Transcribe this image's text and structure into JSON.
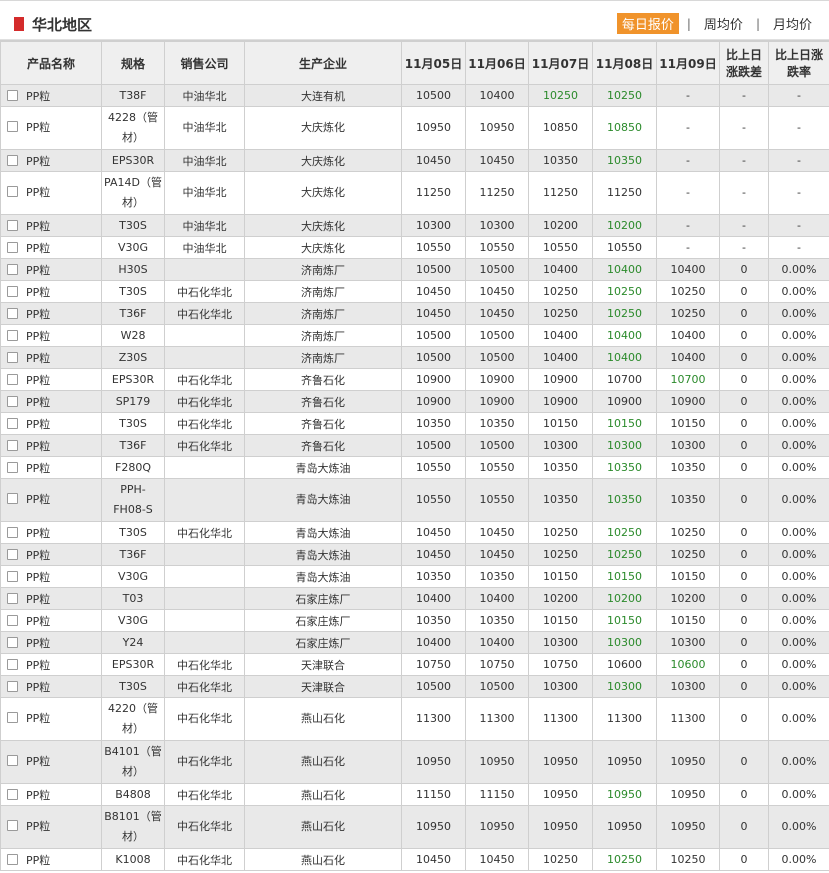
{
  "region": {
    "title": "华北地区"
  },
  "tabs": [
    "每日报价",
    "周均价",
    "月均价"
  ],
  "colors": {
    "accent": "#f0932b",
    "region_mark": "#d42b2b",
    "price_down": "#2b8a2b"
  },
  "columns": [
    "产品名称",
    "规格",
    "销售公司",
    "生产企业",
    "11月05日",
    "11月06日",
    "11月07日",
    "11月08日",
    "11月09日",
    "比上日涨跌差",
    "比上日涨跌率"
  ],
  "rows": [
    {
      "product": "PP粒",
      "spec": "T38F",
      "seller": "中油华北",
      "maker": "大连有机",
      "p1": "10500",
      "p2": "10400",
      "p3": "10250",
      "p4": "10250",
      "p5": "-",
      "diff": "-",
      "rate": "-",
      "down": [
        2,
        3
      ],
      "tall": false
    },
    {
      "product": "PP粒",
      "spec": "4228（管材）",
      "seller": "中油华北",
      "maker": "大庆炼化",
      "p1": "10950",
      "p2": "10950",
      "p3": "10850",
      "p4": "10850",
      "p5": "-",
      "diff": "-",
      "rate": "-",
      "down": [
        3
      ],
      "tall": true
    },
    {
      "product": "PP粒",
      "spec": "EPS30R",
      "seller": "中油华北",
      "maker": "大庆炼化",
      "p1": "10450",
      "p2": "10450",
      "p3": "10350",
      "p4": "10350",
      "p5": "-",
      "diff": "-",
      "rate": "-",
      "down": [
        3
      ],
      "tall": false
    },
    {
      "product": "PP粒",
      "spec": "PA14D（管材）",
      "seller": "中油华北",
      "maker": "大庆炼化",
      "p1": "11250",
      "p2": "11250",
      "p3": "11250",
      "p4": "11250",
      "p5": "-",
      "diff": "-",
      "rate": "-",
      "down": [],
      "tall": true
    },
    {
      "product": "PP粒",
      "spec": "T30S",
      "seller": "中油华北",
      "maker": "大庆炼化",
      "p1": "10300",
      "p2": "10300",
      "p3": "10200",
      "p4": "10200",
      "p5": "-",
      "diff": "-",
      "rate": "-",
      "down": [
        3
      ],
      "tall": false
    },
    {
      "product": "PP粒",
      "spec": "V30G",
      "seller": "中油华北",
      "maker": "大庆炼化",
      "p1": "10550",
      "p2": "10550",
      "p3": "10550",
      "p4": "10550",
      "p5": "-",
      "diff": "-",
      "rate": "-",
      "down": [],
      "tall": false
    },
    {
      "product": "PP粒",
      "spec": "H30S",
      "seller": "",
      "maker": "济南炼厂",
      "p1": "10500",
      "p2": "10500",
      "p3": "10400",
      "p4": "10400",
      "p5": "10400",
      "diff": "0",
      "rate": "0.00%",
      "down": [
        3
      ],
      "tall": false
    },
    {
      "product": "PP粒",
      "spec": "T30S",
      "seller": "中石化华北",
      "maker": "济南炼厂",
      "p1": "10450",
      "p2": "10450",
      "p3": "10250",
      "p4": "10250",
      "p5": "10250",
      "diff": "0",
      "rate": "0.00%",
      "down": [
        3
      ],
      "tall": false
    },
    {
      "product": "PP粒",
      "spec": "T36F",
      "seller": "中石化华北",
      "maker": "济南炼厂",
      "p1": "10450",
      "p2": "10450",
      "p3": "10250",
      "p4": "10250",
      "p5": "10250",
      "diff": "0",
      "rate": "0.00%",
      "down": [
        3
      ],
      "tall": false
    },
    {
      "product": "PP粒",
      "spec": "W28",
      "seller": "",
      "maker": "济南炼厂",
      "p1": "10500",
      "p2": "10500",
      "p3": "10400",
      "p4": "10400",
      "p5": "10400",
      "diff": "0",
      "rate": "0.00%",
      "down": [
        3
      ],
      "tall": false
    },
    {
      "product": "PP粒",
      "spec": "Z30S",
      "seller": "",
      "maker": "济南炼厂",
      "p1": "10500",
      "p2": "10500",
      "p3": "10400",
      "p4": "10400",
      "p5": "10400",
      "diff": "0",
      "rate": "0.00%",
      "down": [
        3
      ],
      "tall": false
    },
    {
      "product": "PP粒",
      "spec": "EPS30R",
      "seller": "中石化华北",
      "maker": "齐鲁石化",
      "p1": "10900",
      "p2": "10900",
      "p3": "10900",
      "p4": "10700",
      "p5": "10700",
      "diff": "0",
      "rate": "0.00%",
      "down": [
        4
      ],
      "tall": false
    },
    {
      "product": "PP粒",
      "spec": "SP179",
      "seller": "中石化华北",
      "maker": "齐鲁石化",
      "p1": "10900",
      "p2": "10900",
      "p3": "10900",
      "p4": "10900",
      "p5": "10900",
      "diff": "0",
      "rate": "0.00%",
      "down": [],
      "tall": false
    },
    {
      "product": "PP粒",
      "spec": "T30S",
      "seller": "中石化华北",
      "maker": "齐鲁石化",
      "p1": "10350",
      "p2": "10350",
      "p3": "10150",
      "p4": "10150",
      "p5": "10150",
      "diff": "0",
      "rate": "0.00%",
      "down": [
        3
      ],
      "tall": false
    },
    {
      "product": "PP粒",
      "spec": "T36F",
      "seller": "中石化华北",
      "maker": "齐鲁石化",
      "p1": "10500",
      "p2": "10500",
      "p3": "10300",
      "p4": "10300",
      "p5": "10300",
      "diff": "0",
      "rate": "0.00%",
      "down": [
        3
      ],
      "tall": false
    },
    {
      "product": "PP粒",
      "spec": "F280Q",
      "seller": "",
      "maker": "青岛大炼油",
      "p1": "10550",
      "p2": "10550",
      "p3": "10350",
      "p4": "10350",
      "p5": "10350",
      "diff": "0",
      "rate": "0.00%",
      "down": [
        3
      ],
      "tall": false
    },
    {
      "product": "PP粒",
      "spec": "PPH-FH08-S",
      "seller": "",
      "maker": "青岛大炼油",
      "p1": "10550",
      "p2": "10550",
      "p3": "10350",
      "p4": "10350",
      "p5": "10350",
      "diff": "0",
      "rate": "0.00%",
      "down": [
        3
      ],
      "tall": true
    },
    {
      "product": "PP粒",
      "spec": "T30S",
      "seller": "中石化华北",
      "maker": "青岛大炼油",
      "p1": "10450",
      "p2": "10450",
      "p3": "10250",
      "p4": "10250",
      "p5": "10250",
      "diff": "0",
      "rate": "0.00%",
      "down": [
        3
      ],
      "tall": false
    },
    {
      "product": "PP粒",
      "spec": "T36F",
      "seller": "",
      "maker": "青岛大炼油",
      "p1": "10450",
      "p2": "10450",
      "p3": "10250",
      "p4": "10250",
      "p5": "10250",
      "diff": "0",
      "rate": "0.00%",
      "down": [
        3
      ],
      "tall": false
    },
    {
      "product": "PP粒",
      "spec": "V30G",
      "seller": "",
      "maker": "青岛大炼油",
      "p1": "10350",
      "p2": "10350",
      "p3": "10150",
      "p4": "10150",
      "p5": "10150",
      "diff": "0",
      "rate": "0.00%",
      "down": [
        3
      ],
      "tall": false
    },
    {
      "product": "PP粒",
      "spec": "T03",
      "seller": "",
      "maker": "石家庄炼厂",
      "p1": "10400",
      "p2": "10400",
      "p3": "10200",
      "p4": "10200",
      "p5": "10200",
      "diff": "0",
      "rate": "0.00%",
      "down": [
        3
      ],
      "tall": false
    },
    {
      "product": "PP粒",
      "spec": "V30G",
      "seller": "",
      "maker": "石家庄炼厂",
      "p1": "10350",
      "p2": "10350",
      "p3": "10150",
      "p4": "10150",
      "p5": "10150",
      "diff": "0",
      "rate": "0.00%",
      "down": [
        3
      ],
      "tall": false
    },
    {
      "product": "PP粒",
      "spec": "Y24",
      "seller": "",
      "maker": "石家庄炼厂",
      "p1": "10400",
      "p2": "10400",
      "p3": "10300",
      "p4": "10300",
      "p5": "10300",
      "diff": "0",
      "rate": "0.00%",
      "down": [
        3
      ],
      "tall": false
    },
    {
      "product": "PP粒",
      "spec": "EPS30R",
      "seller": "中石化华北",
      "maker": "天津联合",
      "p1": "10750",
      "p2": "10750",
      "p3": "10750",
      "p4": "10600",
      "p5": "10600",
      "diff": "0",
      "rate": "0.00%",
      "down": [
        4
      ],
      "tall": false
    },
    {
      "product": "PP粒",
      "spec": "T30S",
      "seller": "中石化华北",
      "maker": "天津联合",
      "p1": "10500",
      "p2": "10500",
      "p3": "10300",
      "p4": "10300",
      "p5": "10300",
      "diff": "0",
      "rate": "0.00%",
      "down": [
        3
      ],
      "tall": false
    },
    {
      "product": "PP粒",
      "spec": "4220（管材）",
      "seller": "中石化华北",
      "maker": "燕山石化",
      "p1": "11300",
      "p2": "11300",
      "p3": "11300",
      "p4": "11300",
      "p5": "11300",
      "diff": "0",
      "rate": "0.00%",
      "down": [],
      "tall": true
    },
    {
      "product": "PP粒",
      "spec": "B4101（管材）",
      "seller": "中石化华北",
      "maker": "燕山石化",
      "p1": "10950",
      "p2": "10950",
      "p3": "10950",
      "p4": "10950",
      "p5": "10950",
      "diff": "0",
      "rate": "0.00%",
      "down": [],
      "tall": true
    },
    {
      "product": "PP粒",
      "spec": "B4808",
      "seller": "中石化华北",
      "maker": "燕山石化",
      "p1": "11150",
      "p2": "11150",
      "p3": "10950",
      "p4": "10950",
      "p5": "10950",
      "diff": "0",
      "rate": "0.00%",
      "down": [
        3
      ],
      "tall": false
    },
    {
      "product": "PP粒",
      "spec": "B8101（管材）",
      "seller": "中石化华北",
      "maker": "燕山石化",
      "p1": "10950",
      "p2": "10950",
      "p3": "10950",
      "p4": "10950",
      "p5": "10950",
      "diff": "0",
      "rate": "0.00%",
      "down": [],
      "tall": true
    },
    {
      "product": "PP粒",
      "spec": "K1008",
      "seller": "中石化华北",
      "maker": "燕山石化",
      "p1": "10450",
      "p2": "10450",
      "p3": "10250",
      "p4": "10250",
      "p5": "10250",
      "diff": "0",
      "rate": "0.00%",
      "down": [
        3
      ],
      "tall": false
    }
  ]
}
